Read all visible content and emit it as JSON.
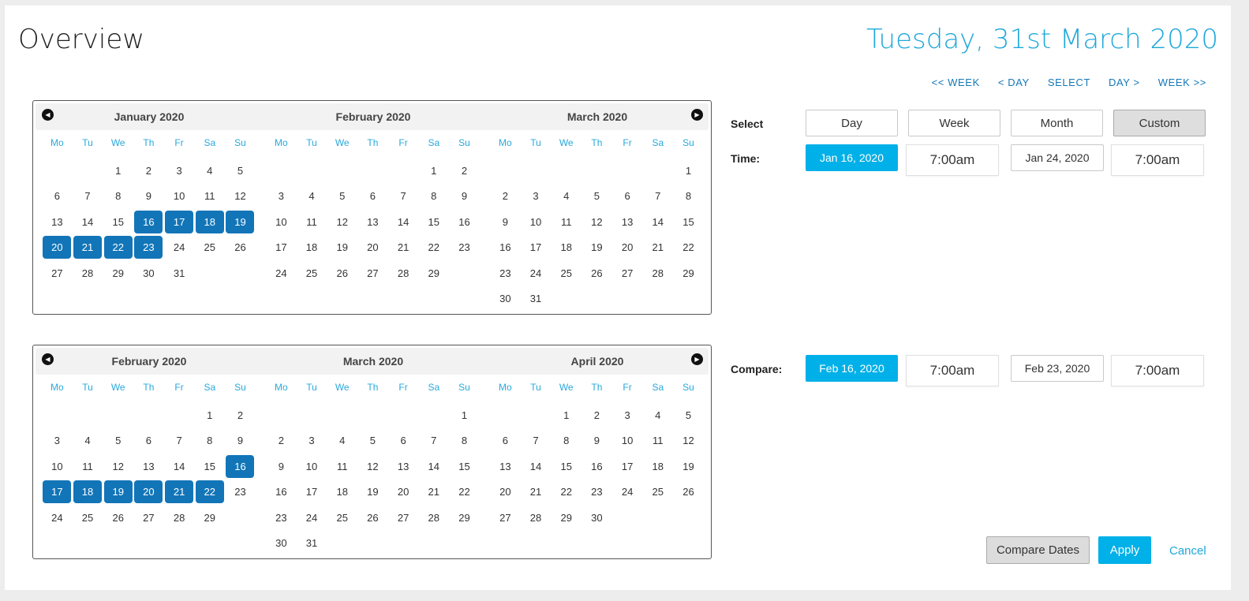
{
  "header": {
    "title": "Overview",
    "current_date": "Tuesday, 31st March 2020"
  },
  "quicknav": [
    "<< WEEK",
    "< DAY",
    "SELECT",
    "DAY >",
    "WEEK >>"
  ],
  "weekdays": [
    "Mo",
    "Tu",
    "We",
    "Th",
    "Fr",
    "Sa",
    "Su"
  ],
  "calendars": [
    {
      "months": [
        {
          "title": "January 2020",
          "offset": 2,
          "days": 31,
          "selected": [
            16,
            17,
            18,
            19,
            20,
            21,
            22,
            23
          ]
        },
        {
          "title": "February 2020",
          "offset": 5,
          "days": 29,
          "selected": []
        },
        {
          "title": "March 2020",
          "offset": 6,
          "days": 31,
          "selected": []
        }
      ]
    },
    {
      "months": [
        {
          "title": "February 2020",
          "offset": 5,
          "days": 29,
          "selected": [
            16,
            17,
            18,
            19,
            20,
            21,
            22
          ]
        },
        {
          "title": "March 2020",
          "offset": 6,
          "days": 31,
          "selected": []
        },
        {
          "title": "April 2020",
          "offset": 2,
          "days": 30,
          "selected": []
        }
      ]
    }
  ],
  "select": {
    "label": "Select",
    "options": [
      "Day",
      "Week",
      "Month",
      "Custom"
    ],
    "active": "Custom"
  },
  "time": {
    "label": "Time:",
    "start_date": "Jan 16, 2020",
    "start_time": "7:00am",
    "end_date": "Jan 24, 2020",
    "end_time": "7:00am"
  },
  "compare": {
    "label": "Compare:",
    "start_date": "Feb 16, 2020",
    "start_time": "7:00am",
    "end_date": "Feb 23, 2020",
    "end_time": "7:00am"
  },
  "actions": {
    "compare_label": "Compare Dates",
    "apply_label": "Apply",
    "cancel_label": "Cancel"
  },
  "colors": {
    "accent": "#00b0e8",
    "selected_day": "#1275b8",
    "weekday": "#28a9dc",
    "nav_link": "#1478b8"
  }
}
